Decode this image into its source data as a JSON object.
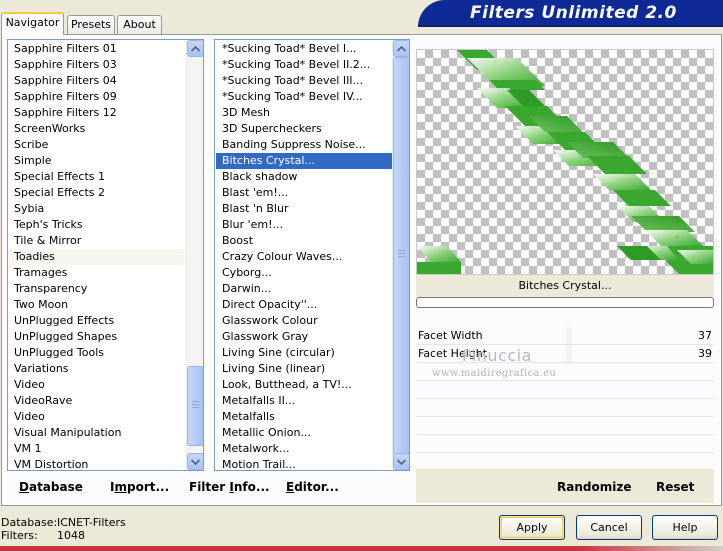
{
  "tabs": {
    "navigator": "Navigator",
    "presets": "Presets",
    "about": "About"
  },
  "app_title": "Filters Unlimited 2.0",
  "categories": [
    "Sapphire Filters 01",
    "Sapphire Filters 03",
    "Sapphire Filters 04",
    "Sapphire Filters 09",
    "Sapphire Filters 12",
    "ScreenWorks",
    "Scribe",
    "Simple",
    "Special Effects 1",
    "Special Effects 2",
    "Sybia",
    "Teph's Tricks",
    "Tile & Mirror",
    "Toadies",
    "Tramages",
    "Transparency",
    "Two Moon",
    "UnPlugged Effects",
    "UnPlugged Shapes",
    "UnPlugged Tools",
    "Variations",
    "Video",
    "VideoRave",
    "Video",
    "Visual Manipulation",
    "VM 1",
    "VM Distortion"
  ],
  "categories_hover_index": 13,
  "filters": [
    "*Sucking Toad*  Bevel I...",
    "*Sucking Toad*  Bevel II.2...",
    "*Sucking Toad*  Bevel III...",
    "*Sucking Toad*  Bevel IV...",
    "3D Mesh",
    "3D Supercheckers",
    "Banding Suppress Noise...",
    "Bitches Crystal...",
    "Black shadow",
    "Blast 'em!...",
    "Blast 'n Blur",
    "Blur 'em!...",
    "Boost",
    "Crazy Colour Waves...",
    "Cyborg...",
    "Darwin...",
    "Direct Opacity''...",
    "Glasswork Colour",
    "Glasswork Gray",
    "Living Sine (circular)",
    "Living Sine (linear)",
    "Look, Butthead, a TV!...",
    "Metalfalls II...",
    "Metalfalls",
    "Metallic Onion...",
    "Metalwork...",
    "Motion Trail..."
  ],
  "filters_selected_index": 7,
  "scroll": {
    "categories_thumb_percent": 100,
    "filters_thumb_percent": 0
  },
  "bottom_buttons": {
    "database": "Database",
    "import": "Import...",
    "filter_info": "Filter Info...",
    "editor": "Editor...",
    "randomize": "Randomize",
    "reset": "Reset"
  },
  "preview": {
    "filter_name": "Bitches Crystal...",
    "green_color": "#3aa82e"
  },
  "params": [
    {
      "label": "Facet Width",
      "value": "37"
    },
    {
      "label": "Facet Height",
      "value": "39"
    }
  ],
  "watermark": {
    "name": "Pinuccia",
    "url": "www.maidiregrafica.eu"
  },
  "footer": {
    "database_label": "Database:",
    "database_value": "ICNET-Filters",
    "filters_label": "Filters:",
    "filters_value": "1048"
  },
  "dialog_buttons": {
    "apply": "Apply",
    "cancel": "Cancel",
    "help": "Help"
  }
}
